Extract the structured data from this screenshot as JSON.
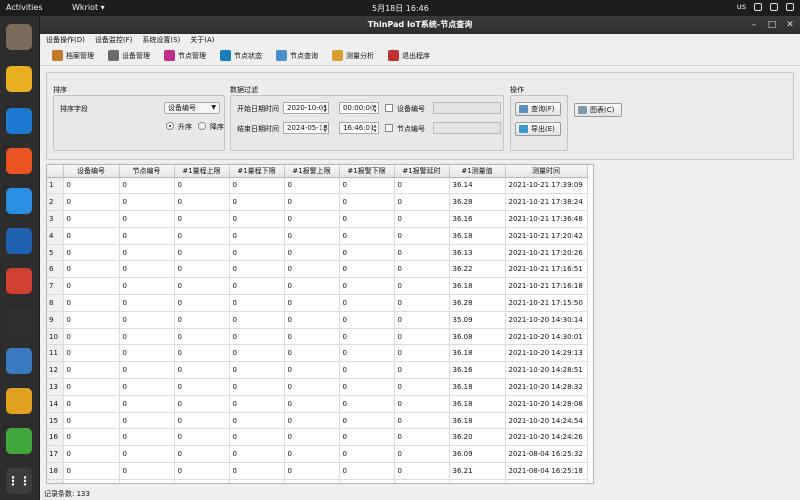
{
  "system": {
    "activities": "Activities",
    "app_name": "Wkriot ▾",
    "clock": "5月18日  16:46",
    "lang": "us"
  },
  "window": {
    "title": "ThinPad IoT系统-节点查询"
  },
  "menu": [
    "设备操作(D)",
    "设备监控(F)",
    "系统设置(S)",
    "关于(A)"
  ],
  "toolbar": [
    {
      "label": "档案管理",
      "color": "#c07a2a"
    },
    {
      "label": "设备管理",
      "color": "#6b6b6b"
    },
    {
      "label": "节点管理",
      "color": "#c0308a"
    },
    {
      "label": "节点状态",
      "color": "#1a7fc0"
    },
    {
      "label": "节点查询",
      "color": "#4a8fd0"
    },
    {
      "label": "测量分析",
      "color": "#d8a030"
    },
    {
      "label": "退出程序",
      "color": "#c03030"
    }
  ],
  "sort": {
    "section_label": "排序",
    "field_label": "排序字段",
    "field_value": "设备编号",
    "asc_label": "升序",
    "desc_label": "降序"
  },
  "filter": {
    "section_label": "数据过滤",
    "start_label": "开始日期时间",
    "start_date": "2020-10-01",
    "start_time": "00:00:00",
    "end_label": "结束日期时间",
    "end_date": "2024-05-18",
    "end_time": "16:46:01",
    "device_label": "设备编号",
    "node_label": "节点编号"
  },
  "actions": {
    "section_label": "操作",
    "query_label": "查询(F)",
    "export_label": "导出(E)",
    "chart_label": "图表(C)"
  },
  "table": {
    "columns": [
      "设备编号",
      "节点编号",
      "#1量程上限",
      "#1量程下限",
      "#1报警上限",
      "#1报警下限",
      "#1报警延时",
      "#1测量值",
      "测量时间"
    ],
    "rows": [
      [
        "1",
        "0",
        "0",
        "0",
        "0",
        "0",
        "0",
        "0",
        "36.14",
        "2021-10-21 17:39:09"
      ],
      [
        "2",
        "0",
        "0",
        "0",
        "0",
        "0",
        "0",
        "0",
        "36.28",
        "2021-10-21 17:38:24"
      ],
      [
        "3",
        "0",
        "0",
        "0",
        "0",
        "0",
        "0",
        "0",
        "36.16",
        "2021-10-21 17:36:48"
      ],
      [
        "4",
        "0",
        "0",
        "0",
        "0",
        "0",
        "0",
        "0",
        "36.18",
        "2021-10-21 17:20:42"
      ],
      [
        "5",
        "0",
        "0",
        "0",
        "0",
        "0",
        "0",
        "0",
        "36.13",
        "2021-10-21 17:20:26"
      ],
      [
        "6",
        "0",
        "0",
        "0",
        "0",
        "0",
        "0",
        "0",
        "36.22",
        "2021-10-21 17:16:51"
      ],
      [
        "7",
        "0",
        "0",
        "0",
        "0",
        "0",
        "0",
        "0",
        "36.18",
        "2021-10-21 17:16:18"
      ],
      [
        "8",
        "0",
        "0",
        "0",
        "0",
        "0",
        "0",
        "0",
        "36.28",
        "2021-10-21 17:15:50"
      ],
      [
        "9",
        "0",
        "0",
        "0",
        "0",
        "0",
        "0",
        "0",
        "35.09",
        "2021-10-20 14:30:14"
      ],
      [
        "10",
        "0",
        "0",
        "0",
        "0",
        "0",
        "0",
        "0",
        "36.08",
        "2021-10-20 14:30:01"
      ],
      [
        "11",
        "0",
        "0",
        "0",
        "0",
        "0",
        "0",
        "0",
        "36.18",
        "2021-10-20 14:29:13"
      ],
      [
        "12",
        "0",
        "0",
        "0",
        "0",
        "0",
        "0",
        "0",
        "36.16",
        "2021-10-20 14:28:51"
      ],
      [
        "13",
        "0",
        "0",
        "0",
        "0",
        "0",
        "0",
        "0",
        "36.18",
        "2021-10-20 14:28:32"
      ],
      [
        "14",
        "0",
        "0",
        "0",
        "0",
        "0",
        "0",
        "0",
        "36.18",
        "2021-10-20 14:28:08"
      ],
      [
        "15",
        "0",
        "0",
        "0",
        "0",
        "0",
        "0",
        "0",
        "36.18",
        "2021-10-20 14:24:54"
      ],
      [
        "16",
        "0",
        "0",
        "0",
        "0",
        "0",
        "0",
        "0",
        "36.20",
        "2021-10-20 14:24:26"
      ],
      [
        "17",
        "0",
        "0",
        "0",
        "0",
        "0",
        "0",
        "0",
        "36.09",
        "2021-08-04 16:25:32"
      ],
      [
        "18",
        "0",
        "0",
        "0",
        "0",
        "0",
        "0",
        "0",
        "36.21",
        "2021-08-04 16:25:18"
      ],
      [
        "19",
        "0",
        "0",
        "0",
        "0",
        "0",
        "0",
        "0",
        "36.34",
        "2021-08-04 16:25:14"
      ]
    ]
  },
  "status": {
    "record_count": "记录条数: 133"
  },
  "dock": [
    {
      "icon": "files-icon",
      "color": "#7a6a5a"
    },
    {
      "icon": "rhythmbox-icon",
      "color": "#e8b020"
    },
    {
      "icon": "writer-icon",
      "color": "#1e7ad0"
    },
    {
      "icon": "app-center-icon",
      "color": "#e95420"
    },
    {
      "icon": "help-icon",
      "color": "#2a8fe0"
    },
    {
      "icon": "monitor-icon",
      "color": "#2060b0"
    },
    {
      "icon": "chrome-icon",
      "color": "#d04030"
    },
    {
      "icon": "terminal-icon",
      "color": "#303030"
    },
    {
      "icon": "win10-vm-icon",
      "color": "#3a7ac0"
    },
    {
      "icon": "kettle-icon",
      "color": "#e0a020"
    },
    {
      "icon": "qt-creator-icon",
      "color": "#41a63c"
    }
  ]
}
